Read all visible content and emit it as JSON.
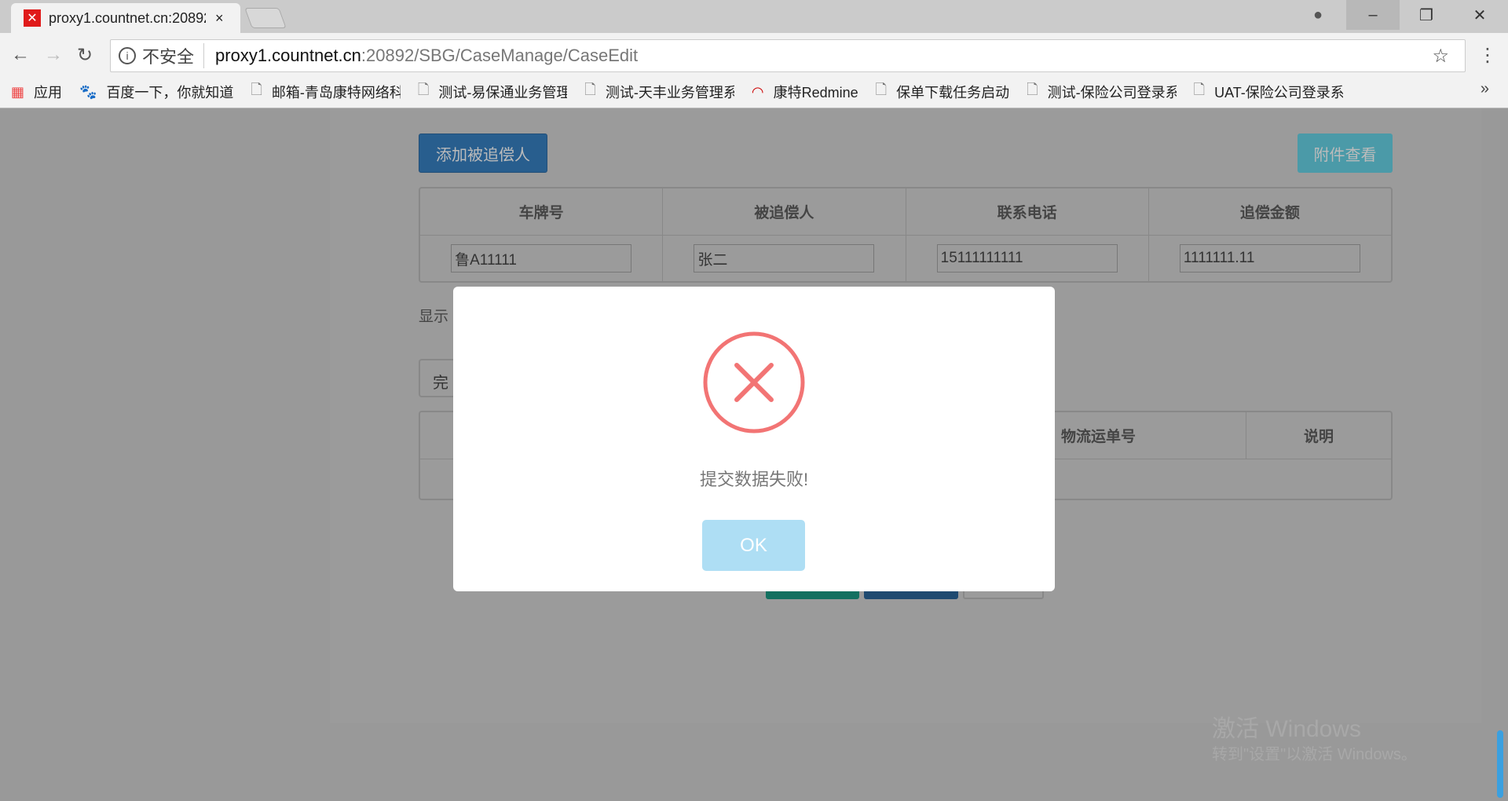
{
  "browser": {
    "tab_title": "proxy1.countnet.cn:20892",
    "url_host": "proxy1.countnet.cn",
    "url_path": ":20892/SBG/CaseManage/CaseEdit",
    "security_label": "不安全",
    "bookmarks": [
      {
        "label": "应用",
        "icon": "apps-icon"
      },
      {
        "label": "百度一下，你就知道",
        "icon": "baidu-icon"
      },
      {
        "label": "邮箱-青岛康特网络科",
        "icon": "page-icon"
      },
      {
        "label": "测试-易保通业务管理",
        "icon": "page-icon"
      },
      {
        "label": "测试-天丰业务管理系",
        "icon": "page-icon"
      },
      {
        "label": "康特Redmine",
        "icon": "redmine-icon"
      },
      {
        "label": "保单下载任务启动",
        "icon": "page-icon"
      },
      {
        "label": "测试-保险公司登录系",
        "icon": "page-icon"
      },
      {
        "label": "UAT-保险公司登录系",
        "icon": "page-icon"
      }
    ]
  },
  "page": {
    "add_button": "添加被追偿人",
    "attachment_button": "附件查看",
    "table1": {
      "headers": [
        "车牌号",
        "被追偿人",
        "联系电话",
        "追偿金额"
      ],
      "row": [
        "鲁A11111",
        "张二",
        "15111111111",
        "1111111.11"
      ]
    },
    "show_label": "显示",
    "complete_box": "完",
    "table2": {
      "headers": [
        "物流运单号",
        "说明"
      ]
    }
  },
  "modal": {
    "message": "提交数据失败!",
    "ok_label": "OK",
    "icon_color": "#f27474"
  },
  "watermark": {
    "line1": "激活 Windows",
    "line2": "转到\"设置\"以激活 Windows。"
  }
}
